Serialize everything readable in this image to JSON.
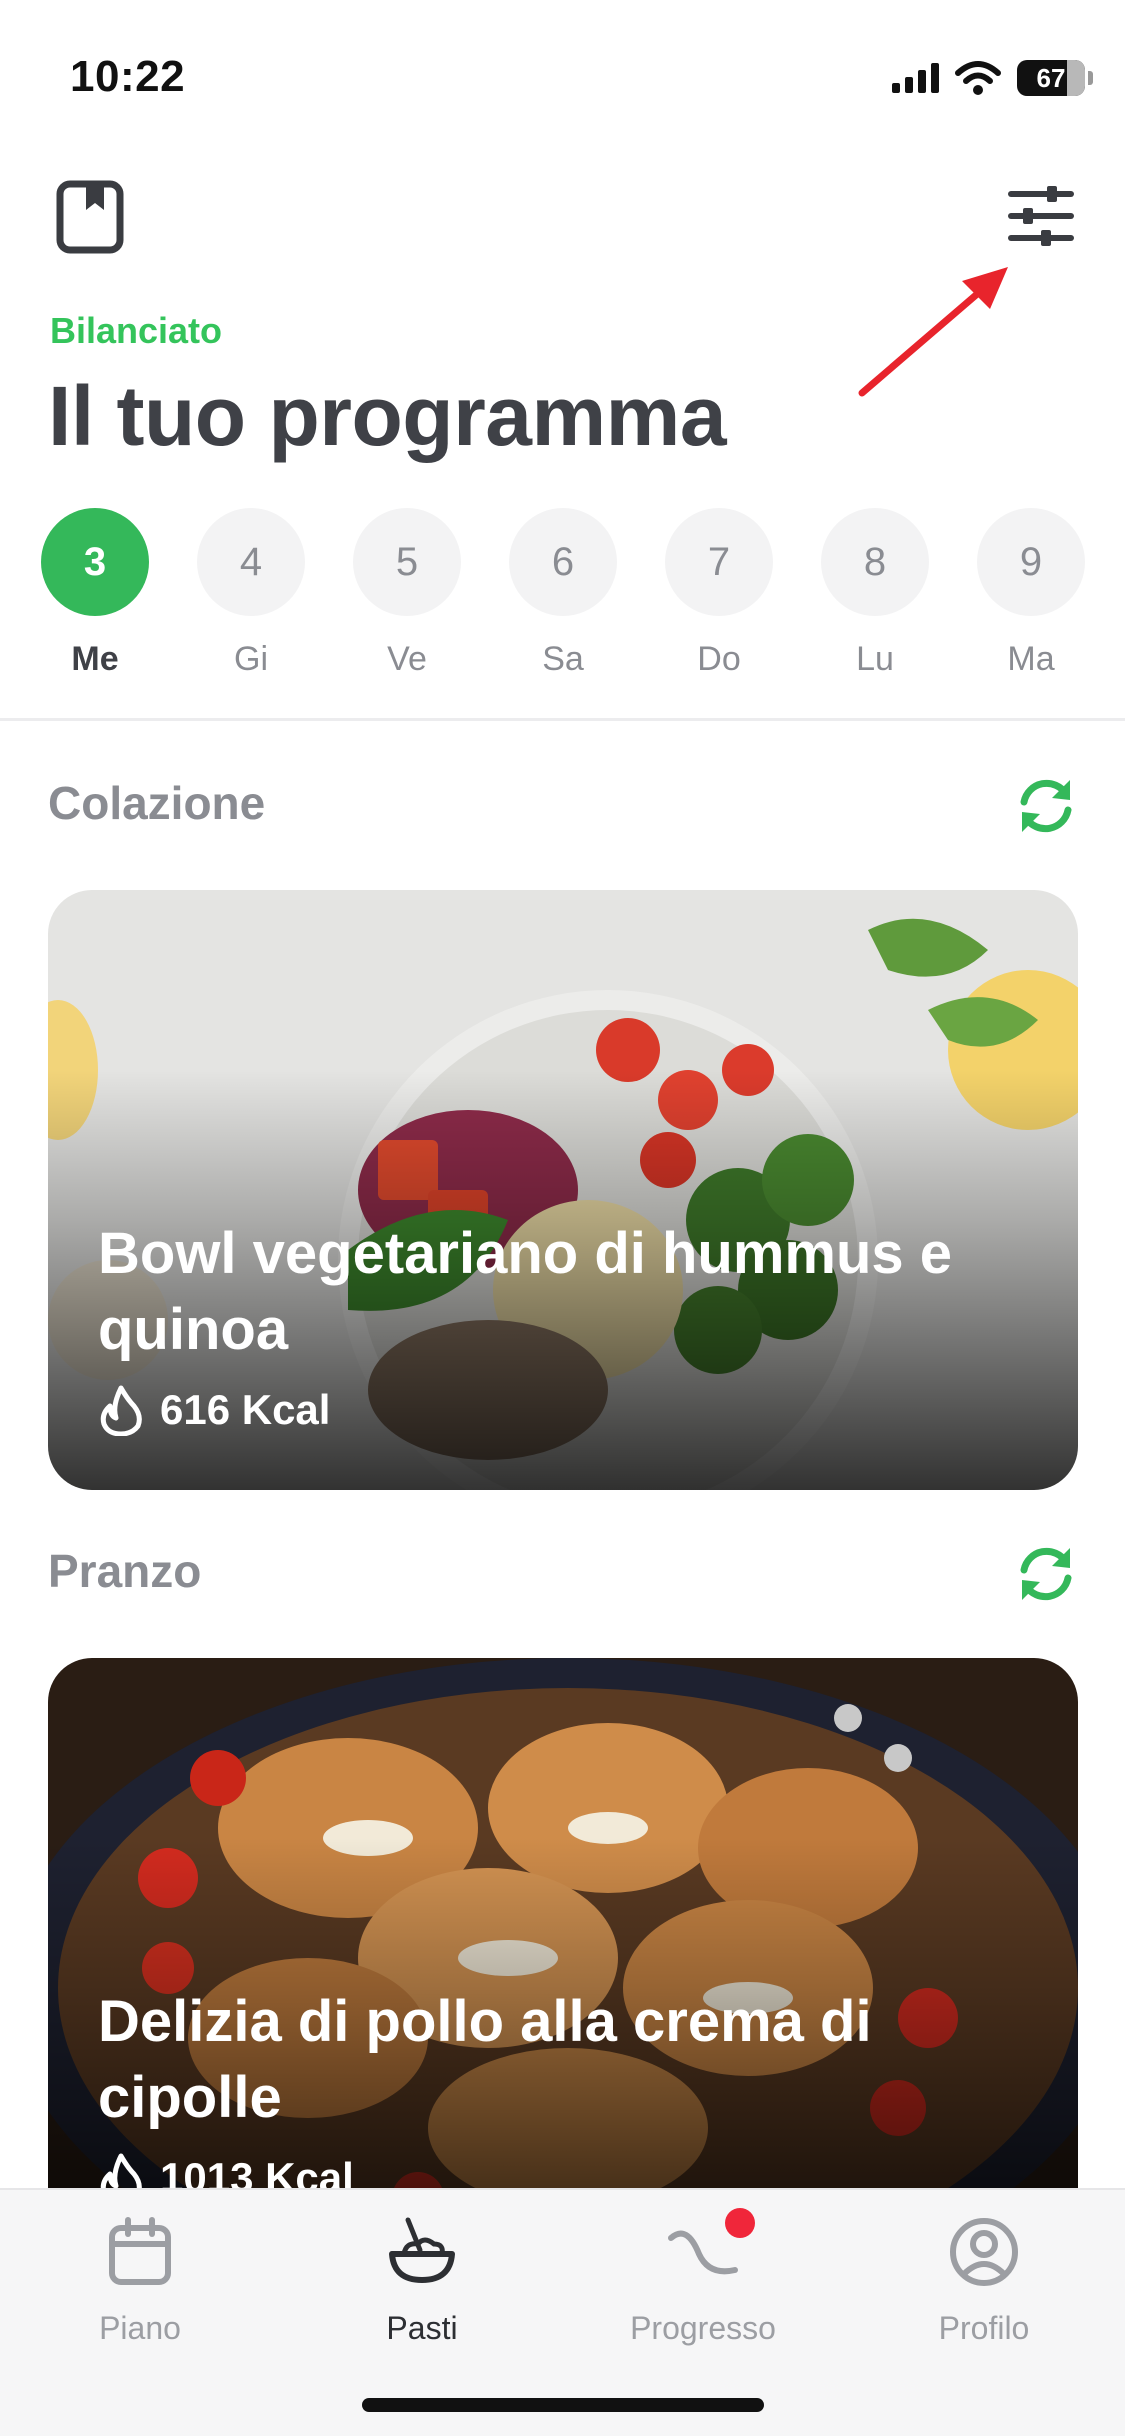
{
  "status_bar": {
    "time": "10:22",
    "battery": "67"
  },
  "header": {
    "diet_label": "Bilanciato",
    "title": "Il tuo programma"
  },
  "days": [
    {
      "num": "3",
      "name": "Me",
      "active": true
    },
    {
      "num": "4",
      "name": "Gi",
      "active": false
    },
    {
      "num": "5",
      "name": "Ve",
      "active": false
    },
    {
      "num": "6",
      "name": "Sa",
      "active": false
    },
    {
      "num": "7",
      "name": "Do",
      "active": false
    },
    {
      "num": "8",
      "name": "Lu",
      "active": false
    },
    {
      "num": "9",
      "name": "Ma",
      "active": false
    }
  ],
  "meals": [
    {
      "section": "Colazione",
      "name": "Bowl vegetariano di hummus e quinoa",
      "kcal": "616 Kcal"
    },
    {
      "section": "Pranzo",
      "name": "Delizia di pollo alla crema di cipolle",
      "kcal": "1013 Kcal"
    }
  ],
  "tabs": [
    {
      "label": "Piano",
      "icon": "calendar-icon"
    },
    {
      "label": "Pasti",
      "icon": "bowl-icon"
    },
    {
      "label": "Progresso",
      "icon": "progress-curve-icon"
    },
    {
      "label": "Profilo",
      "icon": "profile-icon"
    }
  ],
  "colors": {
    "accent": "#34b85a",
    "title": "#3f4147",
    "muted": "#8a8c92",
    "badge": "#f0263a",
    "annotation": "#e8242c"
  }
}
